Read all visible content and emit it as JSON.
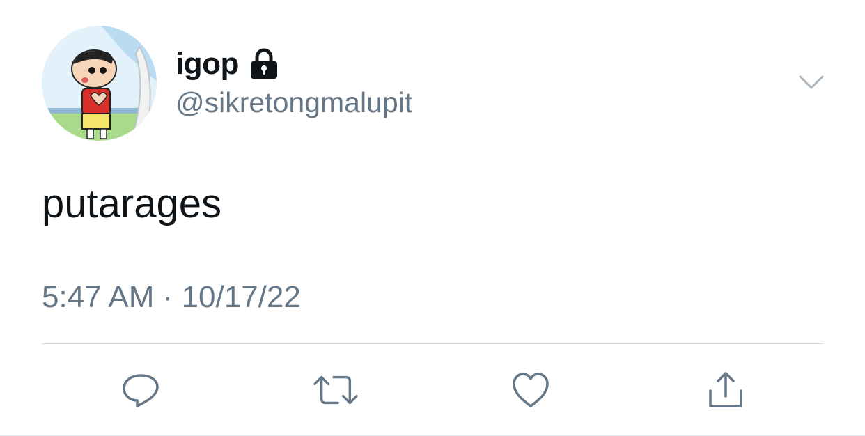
{
  "tweet": {
    "display_name": "igop",
    "handle": "@sikretongmalupit",
    "text": "putarages",
    "time": "5:47 AM",
    "separator": "·",
    "date": "10/17/22"
  },
  "icons": {
    "account_status": "lock-icon",
    "menu": "chevron-down-icon",
    "actions": [
      "reply-icon",
      "retweet-icon",
      "like-icon",
      "share-icon"
    ]
  },
  "colors": {
    "text_primary": "#0f1419",
    "text_secondary": "#657786",
    "icon": "#657786",
    "divider": "#d4d9dd"
  }
}
